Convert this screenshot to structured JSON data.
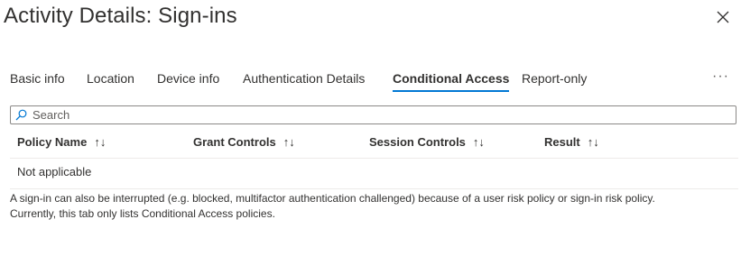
{
  "panel": {
    "title": "Activity Details: Sign-ins"
  },
  "tabs": [
    {
      "label": "Basic info",
      "active": false
    },
    {
      "label": "Location",
      "active": false
    },
    {
      "label": "Device info",
      "active": false
    },
    {
      "label": "Authentication Details",
      "active": false
    },
    {
      "label": "Conditional Access",
      "active": true
    },
    {
      "label": "Report-only",
      "active": false
    }
  ],
  "more_label": "···",
  "search": {
    "placeholder": "Search",
    "value": ""
  },
  "table": {
    "columns": [
      "Policy Name",
      "Grant Controls",
      "Session Controls",
      "Result"
    ],
    "sort_glyph": "↑↓",
    "rows": [
      {
        "text": "Not applicable"
      }
    ]
  },
  "note": {
    "line1": "A sign-in can also be interrupted (e.g. blocked, multifactor authentication challenged) because of a user risk policy or sign-in risk policy.",
    "line2": "Currently, this tab only lists Conditional Access policies."
  },
  "colors": {
    "accent": "#0078d4",
    "text": "#323130",
    "border": "#8a8886",
    "divider": "#edebe9"
  },
  "icons": {
    "close": "close-icon",
    "search": "search-icon",
    "sort": "sort-icon",
    "more": "more-icon"
  }
}
